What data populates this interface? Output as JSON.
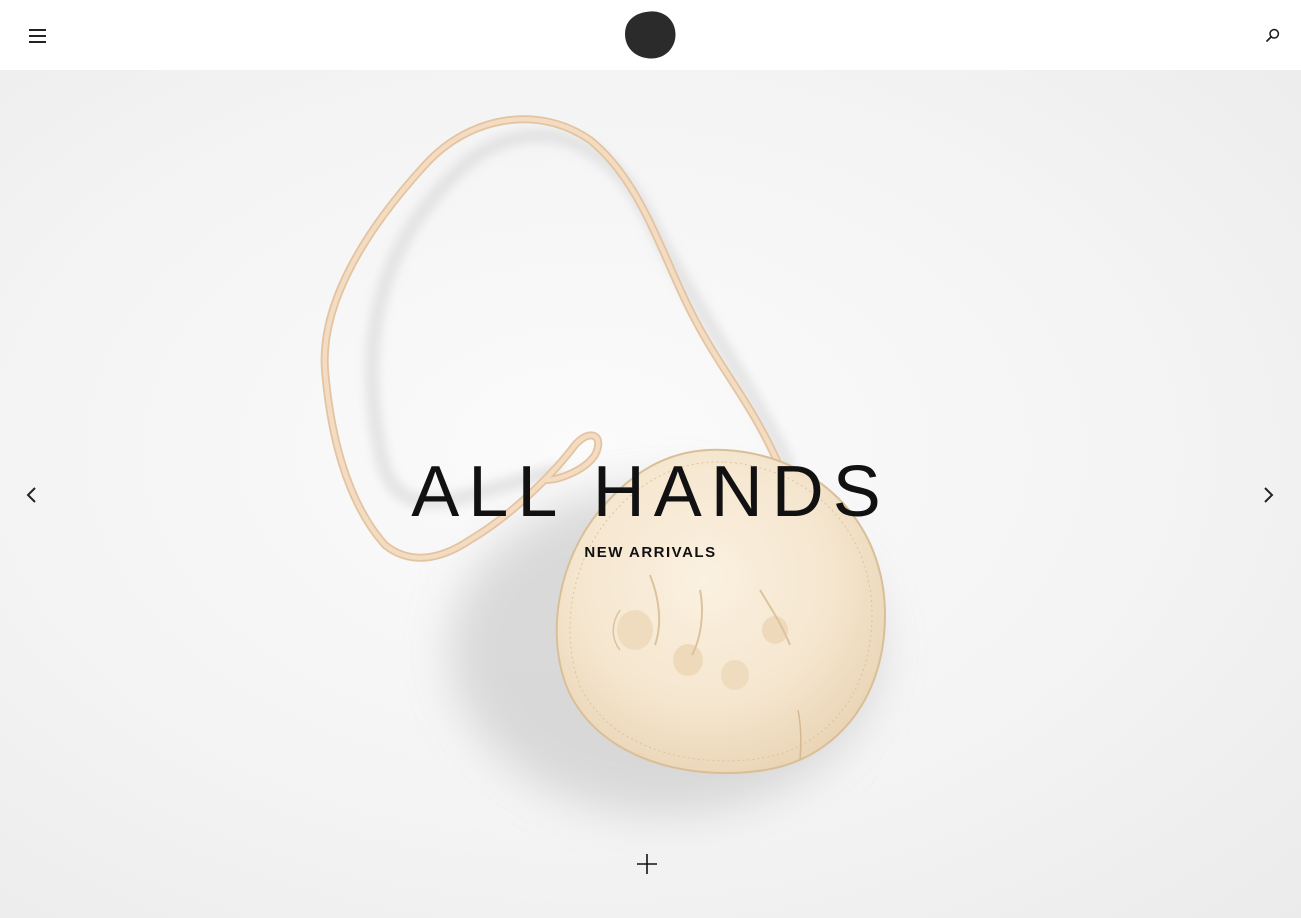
{
  "header": {
    "menu_icon": "hamburger-menu-icon",
    "logo_icon": "circle-logo-icon",
    "search_icon": "search-icon"
  },
  "hero": {
    "title": "ALL HANDS",
    "subtitle": "NEW ARRIVALS",
    "prev_icon": "chevron-left-icon",
    "next_icon": "chevron-right-icon",
    "expand_icon": "plus-icon"
  },
  "colors": {
    "text": "#111111",
    "logo": "#2b2b2b",
    "background": "#ffffff",
    "hero_background": "#f4f4f4",
    "bag_leather": "#f5e6cf",
    "strap_leather": "#efd2b2"
  }
}
